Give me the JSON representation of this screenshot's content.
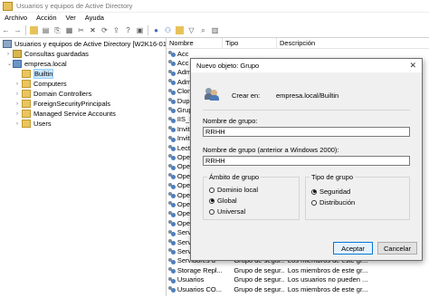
{
  "window": {
    "title": "Usuarios y equipos de Active Directory"
  },
  "menu": [
    "Archivo",
    "Acción",
    "Ver",
    "Ayuda"
  ],
  "toolbar": {
    "icons": [
      "back-icon",
      "forward-icon",
      "up-folder-icon",
      "view-icon",
      "copy-icon",
      "properties-icon",
      "cut-icon",
      "delete-icon",
      "refresh-icon",
      "export-icon",
      "help-icon",
      "view2-icon",
      "user-add-icon",
      "group-add-icon",
      "ou-add-icon",
      "filter-icon",
      "find-icon",
      "delegate-icon"
    ]
  },
  "tree": {
    "root": "Usuarios y equipos de Active Directory [W2K16-01.em",
    "saved_queries": "Consultas guardadas",
    "domain": "empresa.local",
    "children": [
      "Builtin",
      "Computers",
      "Domain Controllers",
      "ForeignSecurityPrincipals",
      "Managed Service Accounts",
      "Users"
    ]
  },
  "list": {
    "columns": [
      "Nombre",
      "Tipo",
      "Descripción"
    ],
    "rows": [
      {
        "name": "Acc",
        "type": "",
        "desc": ""
      },
      {
        "name": "Acc",
        "type": "",
        "desc": ""
      },
      {
        "name": "Adm",
        "type": "",
        "desc": ""
      },
      {
        "name": "Adm",
        "type": "",
        "desc": ""
      },
      {
        "name": "Clon",
        "type": "",
        "desc": ""
      },
      {
        "name": "Dup",
        "type": "",
        "desc": ""
      },
      {
        "name": "Grup",
        "type": "",
        "desc": ""
      },
      {
        "name": "IIS_II",
        "type": "",
        "desc": ""
      },
      {
        "name": "Invit",
        "type": "",
        "desc": ""
      },
      {
        "name": "Invit",
        "type": "",
        "desc": ""
      },
      {
        "name": "Lect",
        "type": "",
        "desc": ""
      },
      {
        "name": "Ope",
        "type": "",
        "desc": ""
      },
      {
        "name": "Ope",
        "type": "",
        "desc": ""
      },
      {
        "name": "Ope",
        "type": "",
        "desc": ""
      },
      {
        "name": "Ope",
        "type": "",
        "desc": ""
      },
      {
        "name": "Ope",
        "type": "",
        "desc": ""
      },
      {
        "name": "Ope",
        "type": "",
        "desc": ""
      },
      {
        "name": "Ope",
        "type": "",
        "desc": ""
      },
      {
        "name": "Ope",
        "type": "",
        "desc": ""
      },
      {
        "name": "Serv",
        "type": "",
        "desc": ""
      },
      {
        "name": "Serv",
        "type": "",
        "desc": ""
      },
      {
        "name": "Serv",
        "type": "",
        "desc": ""
      },
      {
        "name": "Servidores d",
        "type": "Grupo de segur...",
        "desc": "Los miembros de este gr..."
      },
      {
        "name": "Storage Repl...",
        "type": "Grupo de segur...",
        "desc": "Los miembros de este gr..."
      },
      {
        "name": "Usuarios",
        "type": "Grupo de segur...",
        "desc": "Los usuarios no pueden ..."
      },
      {
        "name": "Usuarios CO...",
        "type": "Grupo de segur...",
        "desc": "Los miembros de este gr..."
      }
    ]
  },
  "dialog": {
    "title": "Nuevo objeto: Grupo",
    "create_in_label": "Crear en:",
    "create_in_value": "empresa.local/Builtin",
    "group_name_label": "Nombre de grupo:",
    "group_name_value": "RRHH",
    "group_name_pre2000_label": "Nombre de grupo (anterior a Windows 2000):",
    "group_name_pre2000_value": "RRHH",
    "scope": {
      "legend": "Ámbito de grupo",
      "options": [
        "Dominio local",
        "Global",
        "Universal"
      ],
      "selected": "Global"
    },
    "type": {
      "legend": "Tipo de grupo",
      "options": [
        "Seguridad",
        "Distribución"
      ],
      "selected": "Seguridad"
    },
    "accept_label": "Aceptar",
    "cancel_label": "Cancelar"
  }
}
